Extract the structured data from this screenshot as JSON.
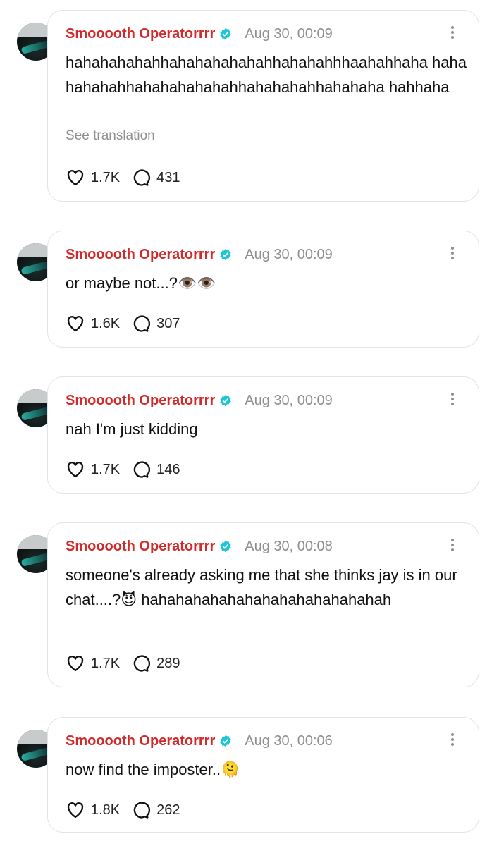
{
  "posts": [
    {
      "author": "Smooooth Operatorrrr",
      "time": "Aug 30, 00:09",
      "text": "hahahahahahhahahahahahahhahahahhhaahahhaha hahahahahahhahahahahahahhahahahahhahahaha hahhaha",
      "translation_label": "See translation",
      "likes": "1.7K",
      "replies": "431"
    },
    {
      "author": "Smooooth Operatorrrr",
      "time": "Aug 30, 00:09",
      "text": "or maybe not...?👁️👁️",
      "likes": "1.6K",
      "replies": "307"
    },
    {
      "author": "Smooooth Operatorrrr",
      "time": "Aug 30, 00:09",
      "text": "nah I'm just kidding",
      "likes": "1.7K",
      "replies": "146"
    },
    {
      "author": "Smooooth Operatorrrr",
      "time": "Aug 30, 00:08",
      "text": "someone's already asking me that she thinks jay is in our chat....?😈 hahahahahahahahahahahahahahah",
      "likes": "1.7K",
      "replies": "289"
    },
    {
      "author": "Smooooth Operatorrrr",
      "time": "Aug 30, 00:06",
      "text": "now find the imposter..🫠",
      "likes": "1.8K",
      "replies": "262"
    }
  ],
  "colors": {
    "author": "#d12a2a",
    "verified": "#1cc6d6",
    "muted": "#8e8e93",
    "border": "#e3e3e8"
  },
  "icons": {
    "like": "heart-outline",
    "reply": "speech-bubble-outline",
    "more": "vertical-ellipsis",
    "verified": "verified-badge"
  }
}
